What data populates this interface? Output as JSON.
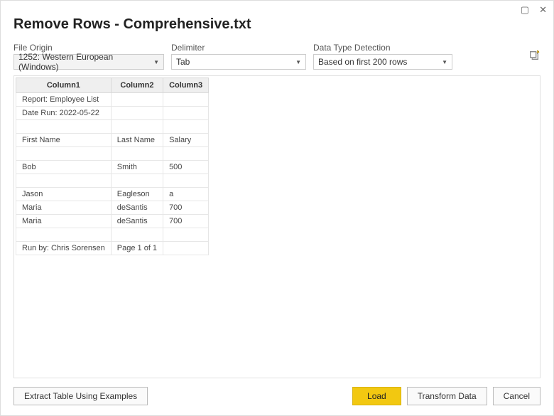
{
  "window": {
    "title": "Remove Rows - Comprehensive.txt"
  },
  "controls": {
    "file_origin": {
      "label": "File Origin",
      "value": "1252: Western European (Windows)"
    },
    "delimiter": {
      "label": "Delimiter",
      "value": "Tab"
    },
    "data_type_detection": {
      "label": "Data Type Detection",
      "value": "Based on first 200 rows"
    }
  },
  "preview": {
    "columns": [
      "Column1",
      "Column2",
      "Column3"
    ],
    "rows": [
      [
        "Report: Employee List",
        "",
        ""
      ],
      [
        "Date Run: 2022-05-22",
        "",
        ""
      ],
      [
        "",
        "",
        ""
      ],
      [
        "First Name",
        "Last Name",
        "Salary"
      ],
      [
        "",
        "",
        ""
      ],
      [
        "Bob",
        "Smith",
        "500"
      ],
      [
        "",
        "",
        ""
      ],
      [
        "Jason",
        "Eagleson",
        "a"
      ],
      [
        "Maria",
        "deSantis",
        "700"
      ],
      [
        "Maria",
        "deSantis",
        "700"
      ],
      [
        "",
        "",
        ""
      ],
      [
        "Run by: Chris Sorensen",
        "Page 1 of 1",
        ""
      ]
    ]
  },
  "buttons": {
    "extract": "Extract Table Using Examples",
    "load": "Load",
    "transform": "Transform Data",
    "cancel": "Cancel"
  },
  "chart_data": {
    "type": "table",
    "columns": [
      "Column1",
      "Column2",
      "Column3"
    ],
    "rows": [
      [
        "Report: Employee List",
        "",
        ""
      ],
      [
        "Date Run: 2022-05-22",
        "",
        ""
      ],
      [
        "",
        "",
        ""
      ],
      [
        "First Name",
        "Last Name",
        "Salary"
      ],
      [
        "",
        "",
        ""
      ],
      [
        "Bob",
        "Smith",
        "500"
      ],
      [
        "",
        "",
        ""
      ],
      [
        "Jason",
        "Eagleson",
        "a"
      ],
      [
        "Maria",
        "deSantis",
        "700"
      ],
      [
        "Maria",
        "deSantis",
        "700"
      ],
      [
        "",
        "",
        ""
      ],
      [
        "Run by: Chris Sorensen",
        "Page 1 of 1",
        ""
      ]
    ]
  }
}
